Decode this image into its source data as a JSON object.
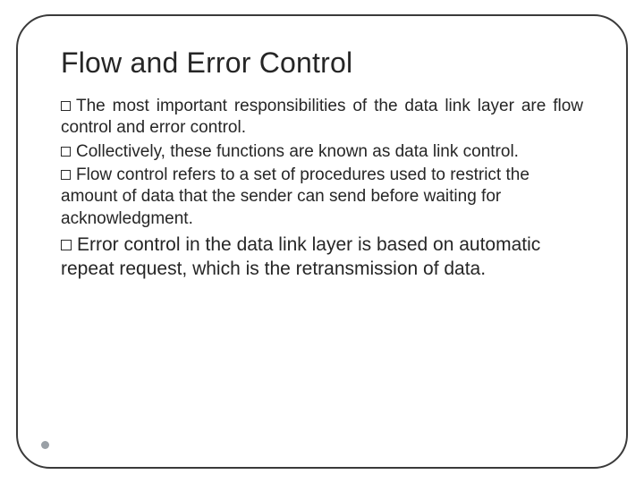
{
  "title": "Flow and Error Control",
  "bullets": {
    "b1": "The most important responsibilities of the data link layer are flow control and error control.",
    "b2": "Collectively, these functions are known as data link control.",
    "b3": "Flow control refers to a set of procedures used to restrict  the amount of data that the sender can send before waiting for acknowledgment.",
    "b4": "Error control in the data link layer is based on automatic repeat request, which is the retransmission of data."
  }
}
